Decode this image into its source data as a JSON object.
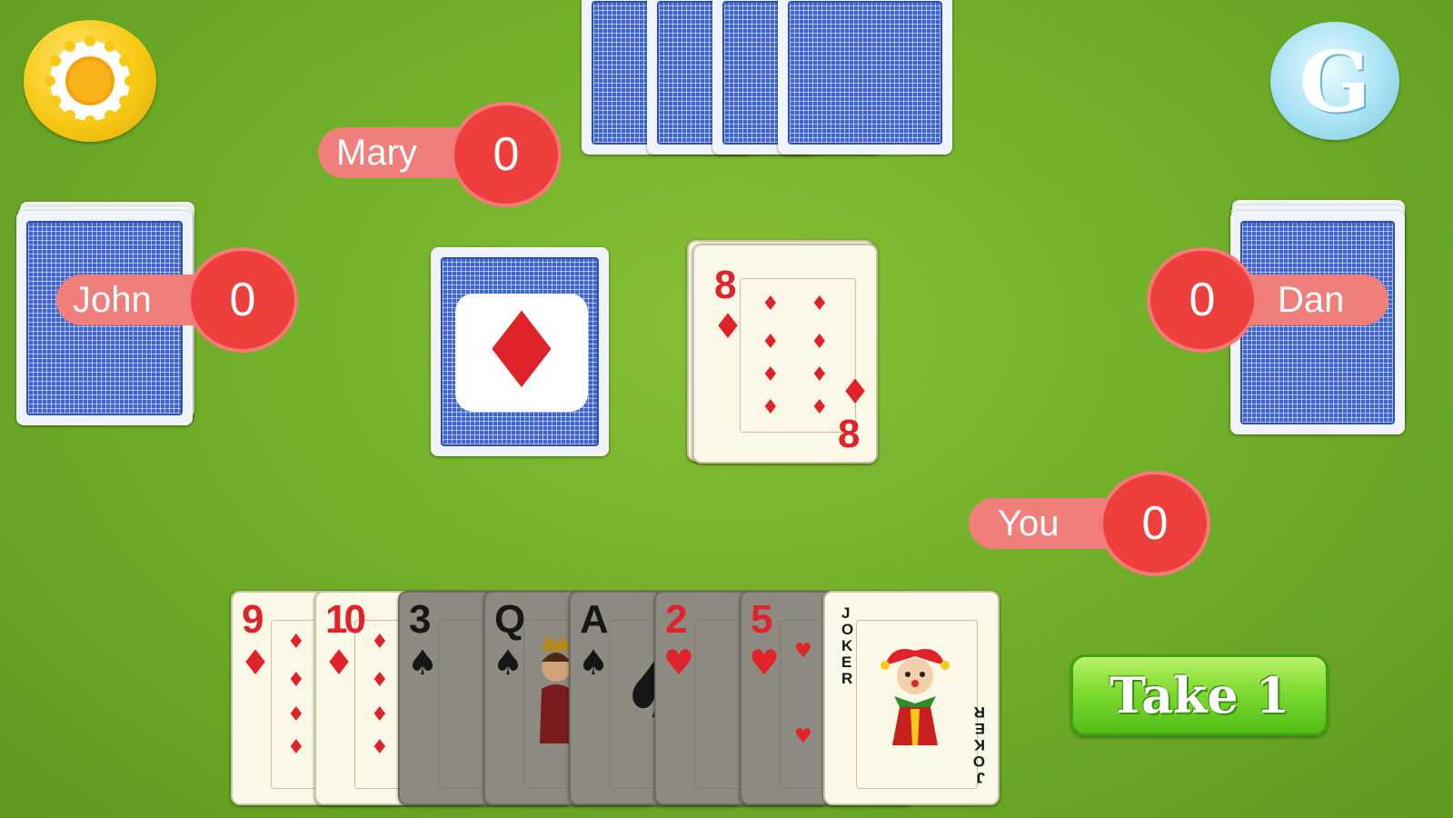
{
  "colors": {
    "felt": "#72b02a",
    "pill": "#f07e7a",
    "score": "#ee3f3d",
    "card_back": "#3d63cc",
    "red_suit": "#e0232a",
    "take_button": "#7fdb2f"
  },
  "icons": {
    "settings": "gear-icon",
    "g_button": "g-icon"
  },
  "g_button": {
    "label": "G"
  },
  "players": {
    "mary": {
      "name": "Mary",
      "score": "0"
    },
    "john": {
      "name": "John",
      "score": "0"
    },
    "dan": {
      "name": "Dan",
      "score": "0"
    },
    "you": {
      "name": "You",
      "score": "0"
    }
  },
  "table": {
    "current_suit": "♦",
    "discard_card": {
      "rank": "8",
      "suit": "♦"
    }
  },
  "hand": [
    {
      "rank": "9",
      "suit": "♦",
      "color": "red",
      "playable": true
    },
    {
      "rank": "10",
      "suit": "♦",
      "color": "red",
      "playable": true
    },
    {
      "rank": "3",
      "suit": "♠",
      "color": "black",
      "playable": false
    },
    {
      "rank": "Q",
      "suit": "♠",
      "color": "black",
      "playable": false
    },
    {
      "rank": "A",
      "suit": "♠",
      "color": "black",
      "playable": false
    },
    {
      "rank": "2",
      "suit": "♥",
      "color": "red",
      "playable": false
    },
    {
      "rank": "5",
      "suit": "♥",
      "color": "red",
      "playable": false
    },
    {
      "rank": "JOKER",
      "suit": "",
      "color": "red",
      "playable": true
    }
  ],
  "actions": {
    "take_label": "Take 1"
  }
}
